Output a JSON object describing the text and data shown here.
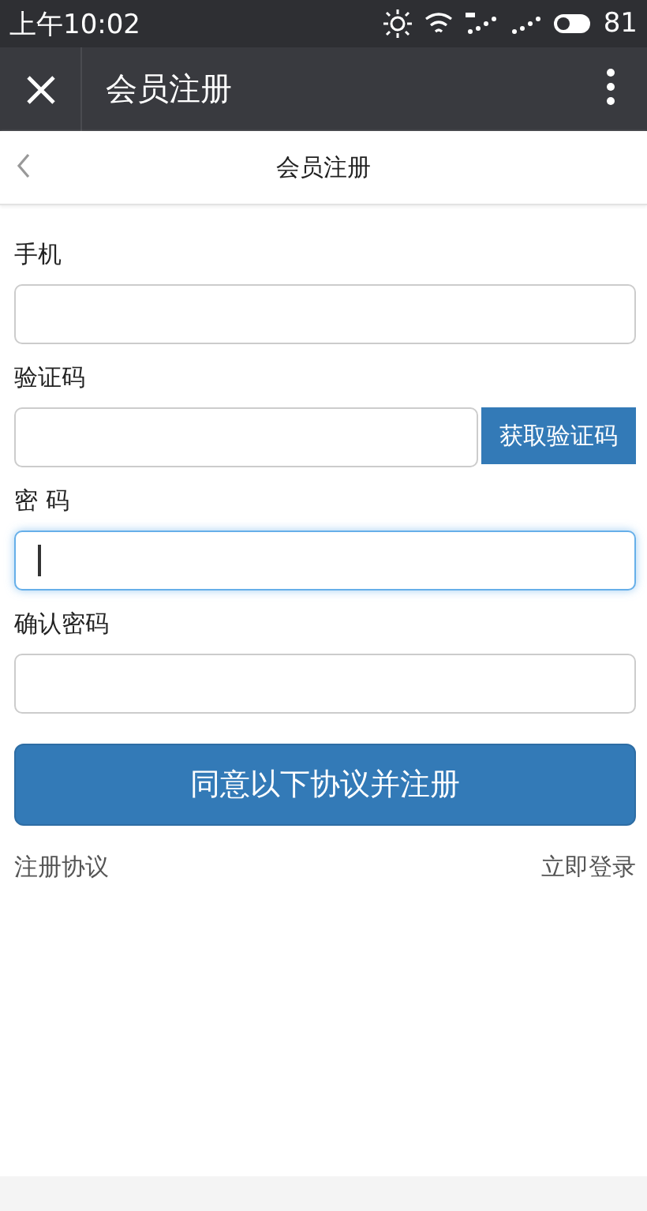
{
  "status_bar": {
    "time": "上午10:02",
    "battery": "81"
  },
  "app_bar": {
    "title": "会员注册"
  },
  "page_header": {
    "title": "会员注册"
  },
  "fields": [
    {
      "label": "手机",
      "focused": false
    },
    {
      "label": "验证码",
      "focused": false,
      "button": "获取验证码"
    },
    {
      "label": "密 码",
      "focused": true
    },
    {
      "label": "确认密码",
      "focused": false
    }
  ],
  "submit_button": "同意以下协议并注册",
  "links": [
    "注册协议",
    "立即登录"
  ]
}
